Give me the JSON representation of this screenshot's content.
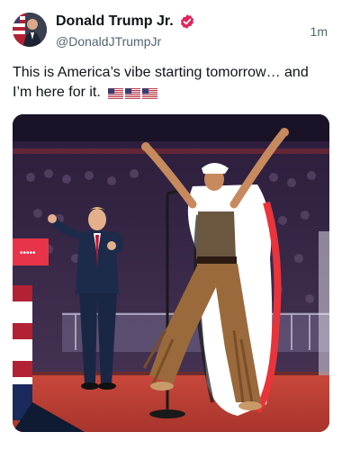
{
  "tweet": {
    "display_name": "Donald Trump Jr.",
    "handle": "@DonaldJTrumpJr",
    "timestamp": "1m",
    "text": "This is America’s vibe starting tomorrow… and I’m here for it.",
    "flag_icons": [
      "us-flag-icon",
      "us-flag-icon",
      "us-flag-icon"
    ],
    "verified_color": "#e0245e",
    "media": {
      "description_icon": "photo",
      "board_text": "•••••",
      "accent_colors": {
        "stage_floor": "#c8473b",
        "crowd": "#3a2a4a",
        "suit": "#1d2b4a",
        "tie": "#c8102e",
        "headdress": "#ffffff",
        "fringe_pants": "#9a6a3c"
      }
    }
  }
}
